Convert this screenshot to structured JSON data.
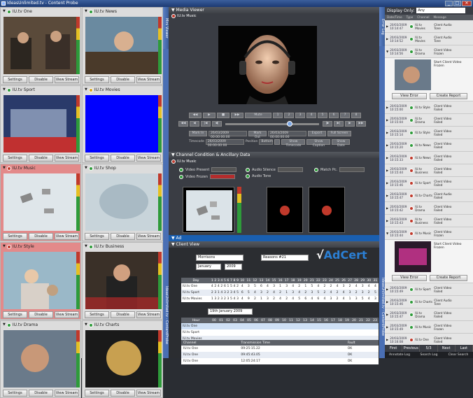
{
  "window": {
    "title": "IdeasUnlimited.tv - Content Probe"
  },
  "tiles": [
    {
      "name": "IU.tv One",
      "status": "green",
      "alert": false
    },
    {
      "name": "IU.tv News",
      "status": "green",
      "alert": false
    },
    {
      "name": "IU.tv Sport",
      "status": "green",
      "alert": false
    },
    {
      "name": "IU.tv Movies",
      "status": "amber",
      "alert": false
    },
    {
      "name": "IU.tv Music",
      "status": "red",
      "alert": true
    },
    {
      "name": "IU.tv Shop",
      "status": "green",
      "alert": false
    },
    {
      "name": "IU.tv Style",
      "status": "red",
      "alert": true
    },
    {
      "name": "IU.tv Business",
      "status": "green",
      "alert": false
    },
    {
      "name": "IU.tv Drama",
      "status": "green",
      "alert": false
    },
    {
      "name": "IU.tv Charts",
      "status": "green",
      "alert": false
    }
  ],
  "tile_buttons": {
    "settings": "Settings",
    "disable": "Disable",
    "view": "View Stream"
  },
  "side_tabs": {
    "mini_viewer": "Mini Viewer",
    "brand_left": "IdeasUnlimited.tv - ContentProbe",
    "brand_right": "IdeasUnlimited.tv - ContentProbe",
    "error_log": "Error Log"
  },
  "media_viewer": {
    "title": "Media Viewer",
    "channel": "IU.tv Music"
  },
  "controls": {
    "mute": "Mute",
    "nums": [
      "1",
      "2",
      "3",
      "4",
      "5",
      "6",
      "7",
      "8"
    ],
    "mark_in": "Mark In",
    "mark_in_time": "26/03/2009 00:00:00:00",
    "mark_out": "Mark Out",
    "mark_out_time": "26/03/2009 00:00:00:00",
    "export": "Export",
    "fullscreen": "Full Screen",
    "timecode_label": "Timecode",
    "timecode_value": "26/03/2009 00:00:00:00",
    "position_label": "Position",
    "position_value": "Bottom",
    "show_timecode": "Show Timecode",
    "show_caption": "Show Caption",
    "show_date": "Show Date"
  },
  "condition": {
    "title": "Channel Condition & Ancillary Data",
    "channel": "IU.tv Music",
    "rows": [
      "Video Present",
      "Video Frozen",
      "Audio Silence",
      "Audio Tone",
      "Match Pc."
    ]
  },
  "adbar": {
    "label": "Ad"
  },
  "client_view": {
    "title": "Client View",
    "client": "Morrisons",
    "reason": "Reasons #21",
    "month": "January",
    "year": "2009",
    "brand": "AdCert",
    "day_label": "Day",
    "days": [
      "1",
      "2",
      "3",
      "4",
      "5",
      "6",
      "7",
      "8",
      "9",
      "10",
      "11",
      "12",
      "13",
      "14",
      "15",
      "16",
      "17",
      "18",
      "19",
      "20",
      "21",
      "22",
      "23",
      "24",
      "25",
      "26",
      "27",
      "28",
      "29",
      "30",
      "31"
    ],
    "cal_rows": [
      {
        "name": "IU.tv One",
        "vals": [
          "4",
          "2",
          "4",
          "2",
          "6",
          "1",
          "5",
          "4",
          "2",
          "4",
          "3",
          "5",
          "6",
          "4",
          "3",
          "1",
          "3",
          "4",
          "2",
          "1",
          "5",
          "4",
          "2",
          "2",
          "4",
          "3",
          "2",
          "4",
          "3",
          "4",
          "4"
        ]
      },
      {
        "name": "IU.tv Sport",
        "vals": [
          "2",
          "3",
          "1",
          "4",
          "3",
          "2",
          "3",
          "4",
          "5",
          "6",
          "5",
          "4",
          "3",
          "2",
          "4",
          "2",
          "1",
          "3",
          "4",
          "2",
          "3",
          "5",
          "2",
          "4",
          "2",
          "4",
          "3",
          "2",
          "3",
          "2",
          "5"
        ]
      },
      {
        "name": "IU.tv Movies",
        "vals": [
          "1",
          "3",
          "2",
          "3",
          "2",
          "3",
          "5",
          "4",
          "3",
          "4",
          "9",
          "2",
          "1",
          "3",
          "2",
          "4",
          "2",
          "4",
          "5",
          "6",
          "4",
          "6",
          "4",
          "3",
          "2",
          "4",
          "1",
          "3",
          "5",
          "4",
          "3"
        ]
      }
    ],
    "date": "19th January 2009",
    "hour_label": "Hour",
    "hours": [
      "00",
      "01",
      "02",
      "03",
      "04",
      "05",
      "06",
      "07",
      "08",
      "09",
      "10",
      "11",
      "12",
      "13",
      "14",
      "15",
      "16",
      "17",
      "18",
      "19",
      "20",
      "21",
      "22",
      "23"
    ],
    "hour_rows": [
      {
        "name": "IU.tv One"
      },
      {
        "name": "IU.tv Sport"
      },
      {
        "name": "IU.tv Movies"
      }
    ],
    "tx_headers": [
      "Channel",
      "Transmission Time",
      "Fault"
    ],
    "tx_rows": [
      {
        "channel": "IU.tv One",
        "time": "09:25:15.22",
        "fault": "OK"
      },
      {
        "channel": "IU.tv One",
        "time": "09:45:43.05",
        "fault": "OK"
      },
      {
        "channel": "IU.tv One",
        "time": "12:05:24:17",
        "fault": "OK"
      }
    ]
  },
  "error_log": {
    "display_label": "Display Only:",
    "display_value": "Any",
    "headers": [
      "Date/Time",
      "Type",
      "Channel",
      "Message"
    ],
    "items": [
      {
        "date": "20/03/2009",
        "time": "10:14:47",
        "status": "green",
        "channel": "IU.tv Movies",
        "msg": "Client Audio Tone"
      },
      {
        "date": "20/03/2009",
        "time": "10:14:52",
        "status": "green",
        "channel": "IU.tv Movies",
        "msg": "Client Audio Tone"
      },
      {
        "date": "20/03/2009",
        "time": "10:14:56",
        "status": "green",
        "channel": "IU.tv Drama",
        "msg": "Client Video Frozen"
      },
      {
        "date": "20/03/2009",
        "time": "10:15:00",
        "status": "green",
        "channel": "IU.tv Style",
        "msg": "Client Video Failed"
      },
      {
        "date": "20/03/2009",
        "time": "10:15:04",
        "status": "green",
        "channel": "IU.tv Drama",
        "msg": "Client Video Failed"
      },
      {
        "date": "20/03/2009",
        "time": "10:15:14",
        "status": "green",
        "channel": "IU.tv Style",
        "msg": "Client Video Failed"
      },
      {
        "date": "20/03/2009",
        "time": "10:15:20",
        "status": "green",
        "channel": "IU.tv News",
        "msg": "Client Video Failed"
      },
      {
        "date": "20/03/2009",
        "time": "10:15:33",
        "status": "red",
        "channel": "IU.tv News",
        "msg": "Client Video Failed"
      },
      {
        "date": "20/03/2009",
        "time": "10:15:44",
        "status": "red",
        "channel": "IU.tv Business",
        "msg": "Client Video Failed"
      },
      {
        "date": "20/03/2009",
        "time": "10:15:46",
        "status": "red",
        "channel": "IU.tv Sport",
        "msg": "Client Video Failed"
      },
      {
        "date": "20/03/2009",
        "time": "10:15:47",
        "status": "red",
        "channel": "IU.tv Charts",
        "msg": "Client Audio Failed"
      },
      {
        "date": "20/03/2009",
        "time": "10:15:42",
        "status": "red",
        "channel": "IU.tv Drama",
        "msg": "Client Video Failed"
      },
      {
        "date": "20/03/2009",
        "time": "10:15:43",
        "status": "red",
        "channel": "IU.tv Business",
        "msg": "Client Video Failed"
      },
      {
        "date": "20/03/2009",
        "time": "10:15:44",
        "status": "red",
        "channel": "IU.tv Music",
        "msg": "Client Video Frozen"
      },
      {
        "date": "20/03/2009",
        "time": "10:15:49",
        "status": "green",
        "channel": "IU.tv Sport",
        "msg": "Client Video Failed"
      },
      {
        "date": "20/03/2009",
        "time": "10:15:46",
        "status": "green",
        "channel": "IU.tv Charts",
        "msg": "Client Audio Tone"
      },
      {
        "date": "20/03/2009",
        "time": "10:15:47",
        "status": "green",
        "channel": "IU.tv Drama",
        "msg": "Client Video Failed"
      },
      {
        "date": "20/03/2009",
        "time": "10:15:49",
        "status": "green",
        "channel": "IU.tv Music",
        "msg": "Client Video Frozen"
      },
      {
        "date": "20/03/2009",
        "time": "10:16:08",
        "status": "red",
        "channel": "IU.tv One",
        "msg": "Client Video Failed"
      }
    ],
    "detail1": "Start Client Video Frozen",
    "detail2": "Start Client Video Frozen",
    "view_error": "View Error",
    "create_report": "Create Report",
    "pager": [
      "First",
      "Previous",
      "5/3",
      "Next",
      "Last"
    ],
    "pager2": [
      "Annotate Log",
      "Search Log",
      "Clear Search"
    ]
  }
}
